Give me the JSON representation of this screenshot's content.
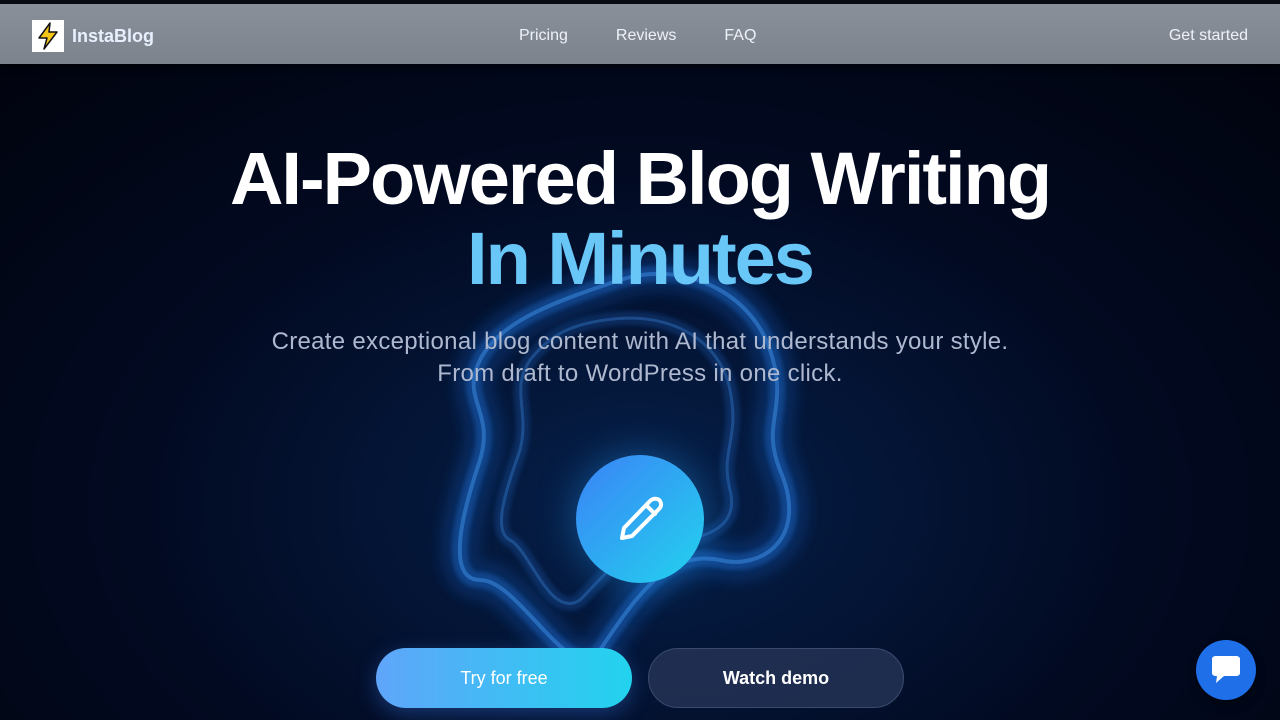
{
  "nav": {
    "brand": "InstaBlog",
    "links": [
      "Pricing",
      "Reviews",
      "FAQ"
    ],
    "cta": "Get started"
  },
  "hero": {
    "title_line1": "AI-Powered Blog Writing",
    "title_line2": "In Minutes",
    "subtitle": "Create exceptional blog content with AI that understands your style. From draft to WordPress in one click.",
    "center_icon": "pencil-icon",
    "primary_button": "Try for free",
    "secondary_button": "Watch demo"
  },
  "chat": {
    "icon": "chat-icon"
  },
  "colors": {
    "accent_blue": "#69c7f7",
    "button_gradient_start": "#60a5fa",
    "button_gradient_end": "#22d3ee",
    "chat_button": "#1f6fe8"
  }
}
